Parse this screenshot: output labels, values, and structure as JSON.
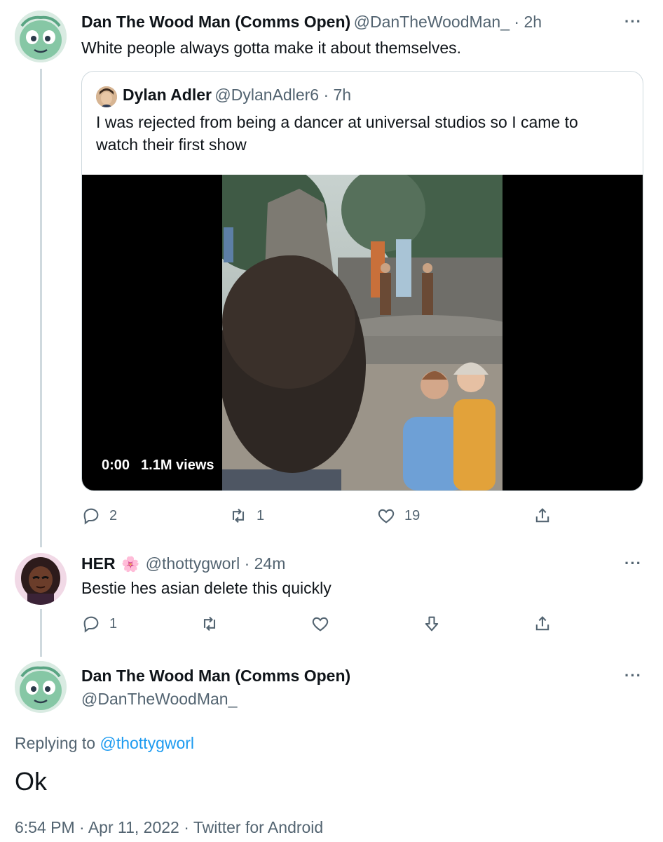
{
  "tweet1": {
    "name": "Dan The Wood Man (Comms Open)",
    "meta": "@DanTheWoodMan_ · 2h",
    "text": "White people always gotta make it about themselves.",
    "quote": {
      "name": "Dylan Adler",
      "meta": "@DylanAdler6 · 7h",
      "text_line1": "I was rejected from being a dancer at universal studios so I came to",
      "text_line2": "watch their first show",
      "video_time": "0:00",
      "video_views": "1.1M views"
    },
    "actions": {
      "replies": "2",
      "retweets": "1",
      "likes": "19"
    }
  },
  "tweet2": {
    "name": "HER",
    "emoji": "🌸",
    "meta": "@thottygworl · 24m",
    "text": "Bestie hes asian delete this quickly",
    "actions": {
      "replies": "1"
    }
  },
  "tweet3": {
    "name": "Dan The Wood Man (Comms Open)",
    "handle": "@DanTheWoodMan_",
    "replying_prefix": "Replying to",
    "replying_to": "@thottygworl",
    "text": "Ok",
    "timestamp": "6:54 PM · Apr 11, 2022 · Twitter for Android"
  },
  "more_icon": "···",
  "colors": {
    "link": "#1d9bf0",
    "secondary": "#536471",
    "border": "#cfd9de",
    "avatar_green": "#8fcfb0"
  }
}
